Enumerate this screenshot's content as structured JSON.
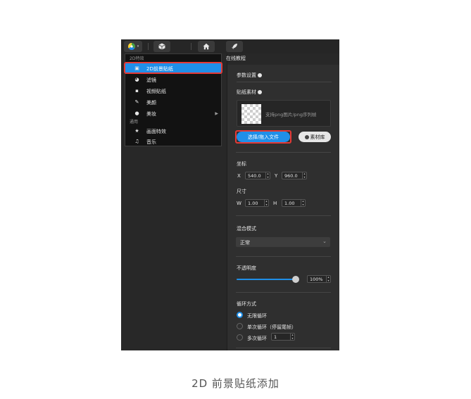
{
  "toolbar": {
    "tutorial_label": "在线教程",
    "icons": [
      "color-wheel-icon",
      "cube-icon",
      "home-icon",
      "rocket-icon"
    ]
  },
  "effects_menu": {
    "group_2d": "2D特效",
    "items_2d": [
      {
        "label": "2D前景贴纸",
        "icon": "sticker-icon",
        "selected": true
      },
      {
        "label": "滤镜",
        "icon": "filter-icon"
      },
      {
        "label": "视频贴纸",
        "icon": "video-sticker-icon"
      },
      {
        "label": "美颜",
        "icon": "beauty-icon"
      },
      {
        "label": "美妆",
        "icon": "makeup-icon",
        "has_submenu": true
      }
    ],
    "group_general": "通用",
    "items_general": [
      {
        "label": "画面特效",
        "icon": "star-icon"
      },
      {
        "label": "音乐",
        "icon": "music-icon"
      }
    ]
  },
  "params": {
    "title": "参数设置",
    "sticker_material_label": "贴纸素材",
    "upload_hint": "支持png图片/png序列帧",
    "select_button": "选择/拖入文件",
    "library_button": "素材库",
    "coords_label": "坐标",
    "x_label": "X",
    "x_value": "540.0",
    "y_label": "Y",
    "y_value": "960.0",
    "size_label": "尺寸",
    "w_label": "W",
    "w_value": "1.00",
    "h_label": "H",
    "h_value": "1.00",
    "blend_label": "混合模式",
    "blend_value": "正常",
    "opacity_label": "不透明度",
    "opacity_value": "100%",
    "opacity_fraction": 1.0,
    "loop_label": "循环方式",
    "loop_options": [
      {
        "label": "无限循环",
        "selected": true
      },
      {
        "label": "单次循环（停留尾帧）",
        "selected": false
      },
      {
        "label": "多次循环",
        "selected": false
      }
    ],
    "loop_count": "1"
  },
  "caption": "2D 前景贴纸添加",
  "colors": {
    "accent": "#1f8fe8",
    "highlight": "#e53935",
    "menu_bg": "#121212",
    "panel_bg": "#2f2f2f"
  }
}
